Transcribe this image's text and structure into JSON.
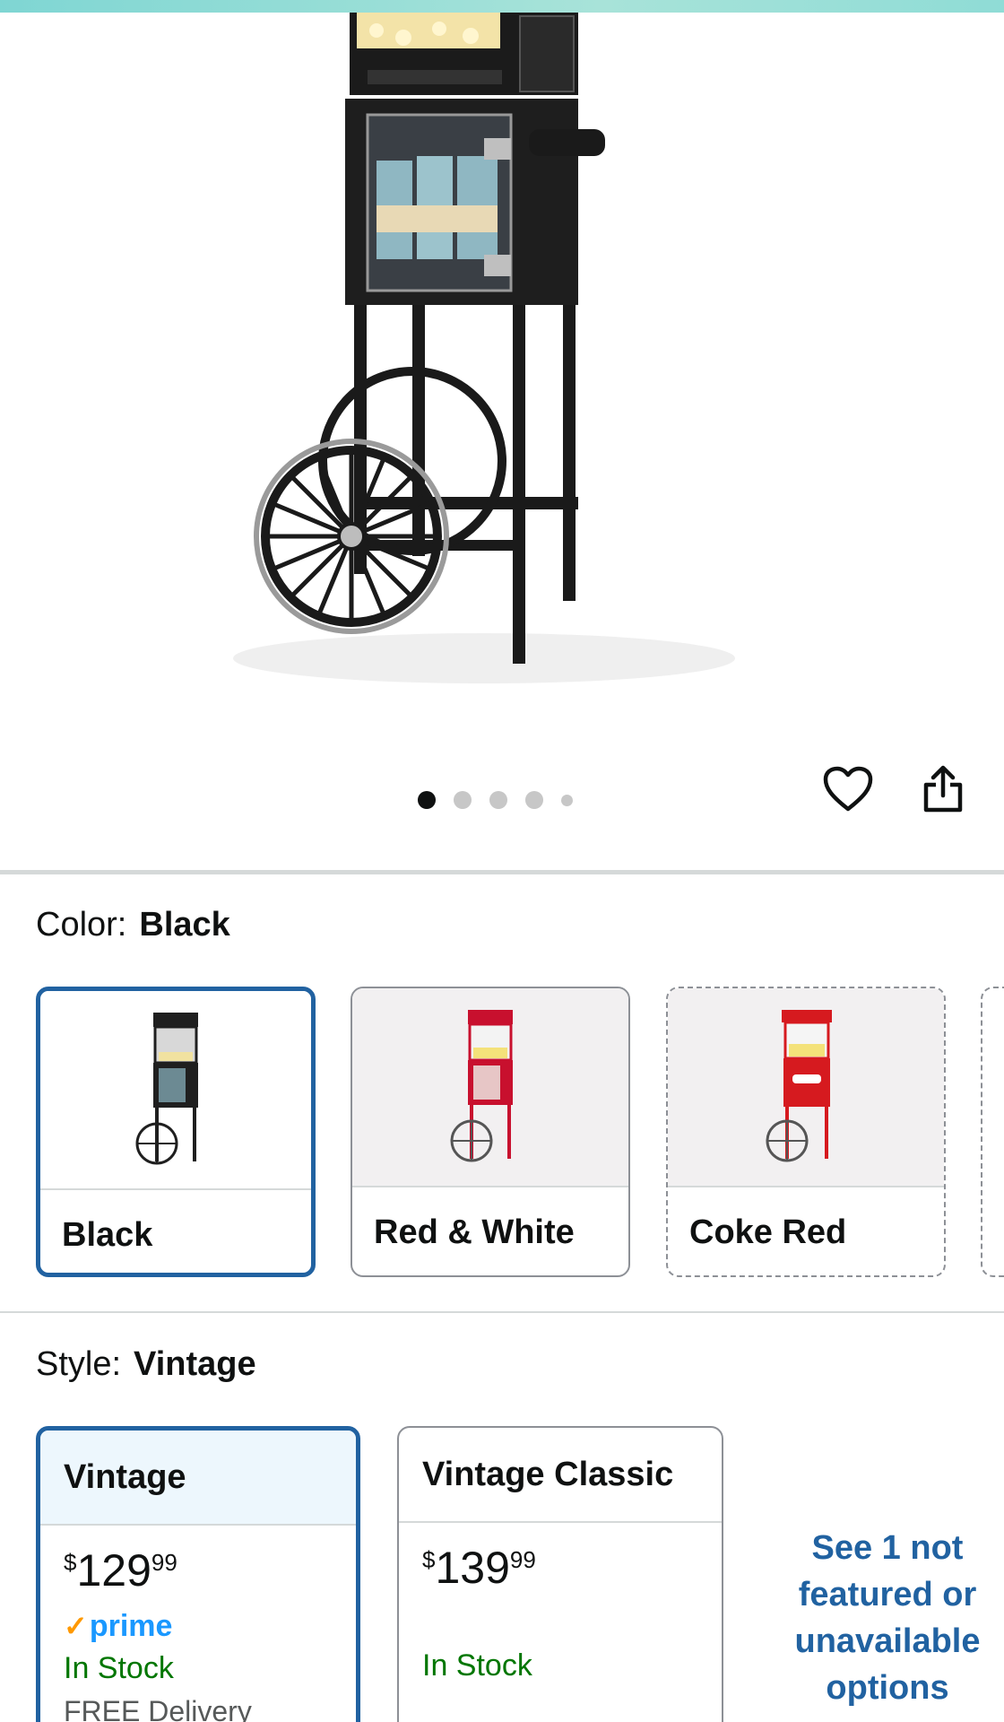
{
  "images": {
    "count": 5,
    "active_index": 0
  },
  "color": {
    "label": "Color:",
    "selected": "Black",
    "options": [
      {
        "name": "Black",
        "state": "selected",
        "cart_color": "#1f1f1f"
      },
      {
        "name": "Red & White",
        "state": "available",
        "cart_color": "#c8102e"
      },
      {
        "name": "Coke Red",
        "state": "unavailable",
        "cart_color": "#d61a1f"
      }
    ]
  },
  "style": {
    "label": "Style:",
    "selected": "Vintage",
    "options": [
      {
        "name": "Vintage",
        "currency": "$",
        "price_whole": "129",
        "price_fraction": "99",
        "prime": "prime",
        "stock": "In Stock",
        "delivery": "FREE Delivery"
      },
      {
        "name": "Vintage Classic",
        "currency": "$",
        "price_whole": "139",
        "price_fraction": "99",
        "stock": "In Stock"
      }
    ],
    "see_more": "See 1 not featured or unavailable options"
  },
  "icons": {
    "wishlist": "heart-icon",
    "share": "share-icon"
  },
  "colors": {
    "accent": "#2162a1",
    "stock_green": "#007600",
    "prime_blue": "#1a98ff",
    "prime_check": "#ff9900"
  }
}
